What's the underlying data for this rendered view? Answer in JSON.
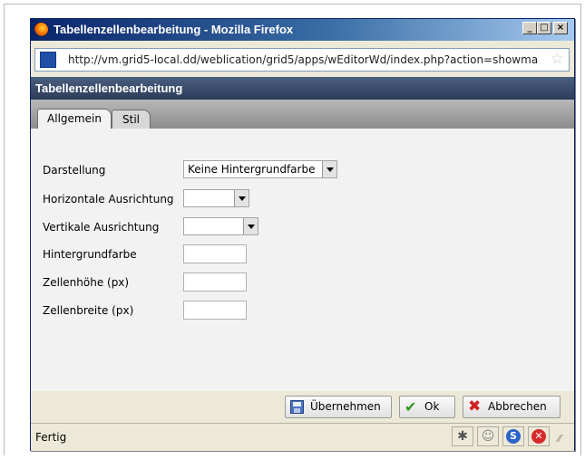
{
  "window": {
    "title": "Tabellenzellenbearbeitung - Mozilla Firefox",
    "controls": {
      "minimize": "_",
      "maximize": "□",
      "close": "×"
    }
  },
  "urlbar": {
    "url": "http://vm.grid5-local.dd/weblication/grid5/apps/wEditorWd/index.php?action=showma",
    "bookmark_icon": "star-icon"
  },
  "dialog": {
    "title": "Tabellenzellenbearbeitung",
    "tabs": [
      {
        "label": "Allgemein",
        "active": true
      },
      {
        "label": "Stil",
        "active": false
      }
    ],
    "fields": [
      {
        "label": "Darstellung",
        "type": "select",
        "value": "Keine Hintergrundfarbe"
      },
      {
        "label": "Horizontale Ausrichtung",
        "type": "select",
        "value": ""
      },
      {
        "label": "Vertikale Ausrichtung",
        "type": "select",
        "value": ""
      },
      {
        "label": "Hintergrundfarbe",
        "type": "text",
        "value": ""
      },
      {
        "label": "Zellenhöhe (px)",
        "type": "text",
        "value": ""
      },
      {
        "label": "Zellenbreite (px)",
        "type": "text",
        "value": ""
      }
    ],
    "buttons": {
      "apply": {
        "label": "Übernehmen",
        "icon": "save-icon"
      },
      "ok": {
        "label": "Ok",
        "icon": "check-icon"
      },
      "cancel": {
        "label": "Abbrechen",
        "icon": "x-icon"
      }
    }
  },
  "statusbar": {
    "text": "Fertig",
    "s_icon_glyph": "S",
    "stop_icon_glyph": "✕"
  }
}
